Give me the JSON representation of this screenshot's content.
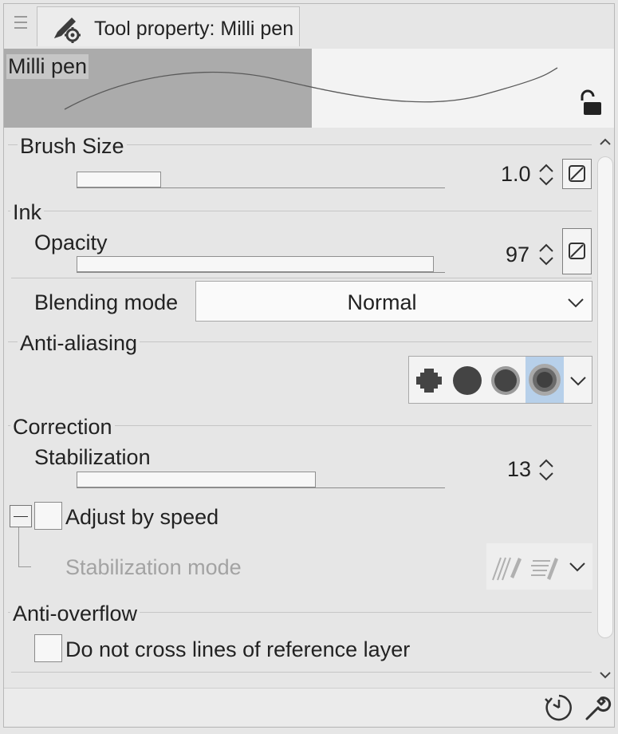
{
  "tab": {
    "title": "Tool property: Milli pen",
    "icon": "pen-gear-icon"
  },
  "menu": {
    "icon": "hamburger-menu-icon"
  },
  "preview": {
    "brush_name": "Milli pen",
    "lock_icon": "unlocked-padlock-icon"
  },
  "brush_size": {
    "label": "Brush Size",
    "value": "1.0",
    "level_fraction": 0.23,
    "spinner_icon": "up-down-chevron-icon",
    "pressure_icon": "pressure-toggle-icon"
  },
  "ink": {
    "label": "Ink",
    "opacity": {
      "label": "Opacity",
      "value": "97",
      "level_fraction": 0.97,
      "spinner_icon": "up-down-chevron-icon",
      "pressure_icon": "pressure-toggle-icon"
    },
    "blending": {
      "label": "Blending mode",
      "value": "Normal",
      "chevron_icon": "chevron-down-icon"
    }
  },
  "anti_aliasing": {
    "label": "Anti-aliasing",
    "options": [
      "none-icon",
      "weak-icon",
      "medium-icon",
      "strong-icon"
    ],
    "selected_index": 3,
    "chevron_icon": "chevron-down-icon"
  },
  "correction": {
    "label": "Correction",
    "stabilization": {
      "label": "Stabilization",
      "value": "13",
      "level_fraction": 0.65,
      "spinner_icon": "up-down-chevron-icon"
    },
    "adjust_by_speed": {
      "label": "Adjust by speed",
      "checked": false
    },
    "stabilization_mode": {
      "label": "Stabilization mode",
      "icons": [
        "stabilization-mode-1-icon",
        "stabilization-mode-2-icon"
      ],
      "chevron_icon": "chevron-down-icon"
    }
  },
  "anti_overflow": {
    "label": "Anti-overflow",
    "do_not_cross": {
      "label": "Do not cross lines of reference layer",
      "checked": false
    }
  },
  "footer": {
    "icons": [
      "reset-clock-icon",
      "wrench-settings-icon"
    ]
  },
  "scrollbar": {
    "up_icon": "chevron-up-icon",
    "down_icon": "chevron-down-icon"
  },
  "colors": {
    "selected_option_bg": "#b7d0ea",
    "preview_bg": "#ababab"
  }
}
